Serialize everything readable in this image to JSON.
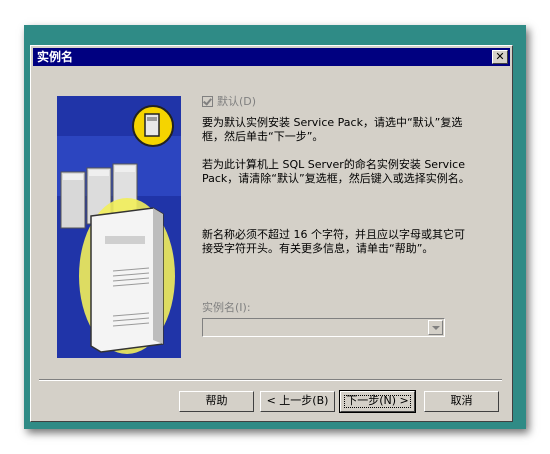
{
  "window": {
    "title": "实例名",
    "close_glyph": "✕"
  },
  "default_checkbox": {
    "label": "默认(D)",
    "checked": true,
    "enabled": false
  },
  "paragraphs": [
    "要为默认实例安装 Service Pack，请选中“默认”复选框，然后单击“下一步”。",
    "若为此计算机上 SQL Server的命名实例安装 Service Pack，请清除“默认”复选框，然后键入或选择实例名。",
    "新名称必须不超过 16 个字符，并且应以字母或其它可接受字符开头。有关更多信息，请单击“帮助”。"
  ],
  "instance_name": {
    "label": "实例名(I):",
    "value": "",
    "enabled": false
  },
  "buttons": {
    "help": "帮助",
    "back": "< 上一步(B)",
    "next": "下一步(N) >",
    "cancel": "取消"
  },
  "colors": {
    "frame": "#2f8b86",
    "titlebar": "#000080",
    "dialog": "#d4d0c8",
    "illustration_blue": "#2034a8",
    "badge_yellow": "#f5d400"
  },
  "icons": [
    "close-icon",
    "server-icon",
    "server-rack-icon",
    "badge-icon",
    "dropdown-arrow-icon",
    "checkbox-icon"
  ]
}
